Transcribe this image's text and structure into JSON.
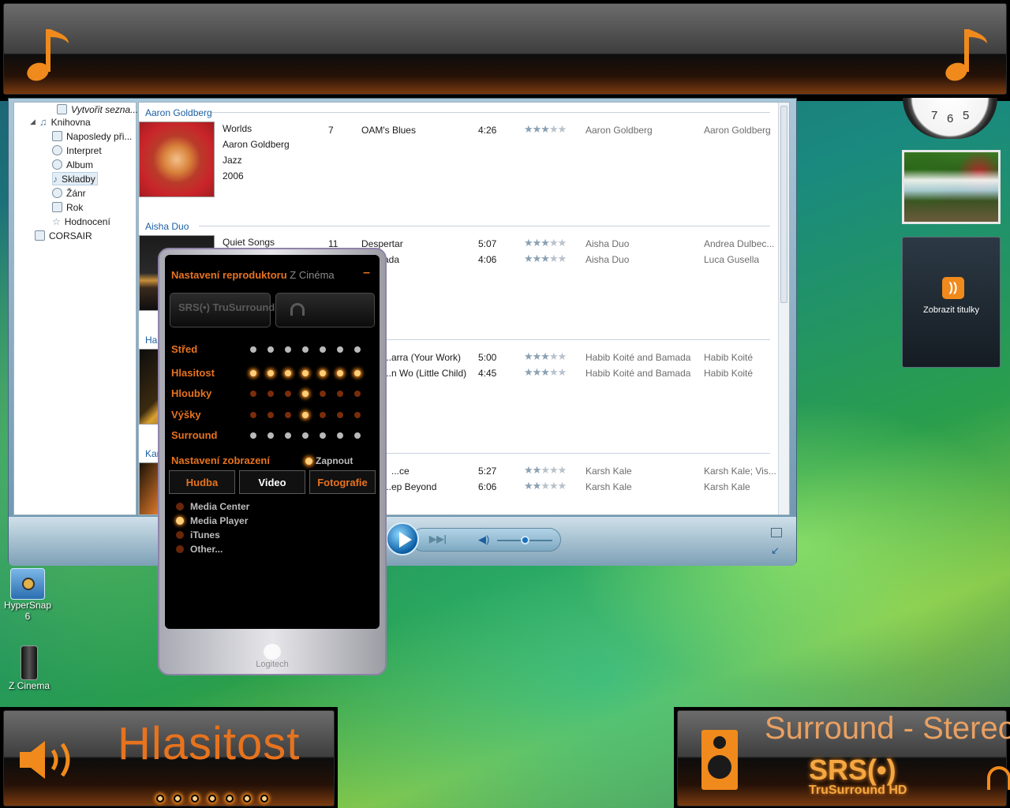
{
  "top_bar": {
    "left_icon": "music-note-icon",
    "right_icon": "music-note-icon"
  },
  "navigation": {
    "items": [
      {
        "label": "Vytvořit sezna...",
        "icon": "playlist-icon"
      },
      {
        "label": "Knihovna",
        "icon": "music-library-icon"
      },
      {
        "label": "Naposledy při...",
        "icon": "recent-icon"
      },
      {
        "label": "Interpret",
        "icon": "artist-icon"
      },
      {
        "label": "Album",
        "icon": "album-icon"
      },
      {
        "label": "Skladby",
        "icon": "song-icon",
        "selected": true
      },
      {
        "label": "Žánr",
        "icon": "genre-icon"
      },
      {
        "label": "Rok",
        "icon": "year-icon"
      },
      {
        "label": "Hodnocení",
        "icon": "rating-star-icon"
      },
      {
        "label": "CORSAIR",
        "icon": "drive-icon"
      }
    ]
  },
  "library": {
    "groups": [
      {
        "artist": "Aaron Goldberg",
        "album": "Worlds",
        "album_artist": "Aaron Goldberg",
        "genre": "Jazz",
        "year": "2006",
        "tracks": [
          {
            "num": "7",
            "title": "OAM's Blues",
            "length": "4:26",
            "rating": 3,
            "contributing": "Aaron Goldberg",
            "composer": "Aaron Goldberg"
          }
        ]
      },
      {
        "artist": "Aisha Duo",
        "album": "Quiet Songs",
        "tracks": [
          {
            "num": "11",
            "title": "Despertar",
            "length": "5:07",
            "rating": 3,
            "contributing": "Aisha Duo",
            "composer": "Andrea Dulbec..."
          },
          {
            "num": "",
            "title": "...ada",
            "length": "4:06",
            "rating": 3,
            "contributing": "Aisha Duo",
            "composer": "Luca Gusella"
          }
        ]
      },
      {
        "artist": "Hal...",
        "tracks": [
          {
            "title": "...arra (Your Work)",
            "length": "5:00",
            "rating": 3,
            "contributing": "Habib Koité and Bamada",
            "composer": "Habib Koité"
          },
          {
            "title": "...n Wo (Little Child)",
            "length": "4:45",
            "rating": 3,
            "contributing": "Habib Koité and Bamada",
            "composer": "Habib Koité"
          }
        ]
      },
      {
        "artist": "Kar...",
        "tracks": [
          {
            "title": "...ce",
            "length": "5:27",
            "rating": 2,
            "contributing": "Karsh Kale",
            "composer": "Karsh Kale; Vis..."
          },
          {
            "title": "...ep Beyond",
            "length": "6:06",
            "rating": 2,
            "contributing": "Karsh Kale",
            "composer": "Karsh Kale"
          }
        ]
      }
    ]
  },
  "player_controls": {
    "play_icon": "play-icon",
    "next_icon": "next-track-icon",
    "volume_icon": "volume-icon",
    "volume_level": 0.5
  },
  "gadgets": {
    "rss_label": "Zobrazit titulky",
    "rss_icon": "rss-feed-icon"
  },
  "desktop_icons": [
    {
      "label": "HyperSnap 6",
      "icon": "camera-icon"
    },
    {
      "label": "Z Cinema",
      "icon": "speaker-icon"
    }
  ],
  "zcinema": {
    "title_prefix": "Nastavení reproduktoru",
    "title_brand": "Z Cinéma",
    "minimize_label": "–",
    "srs_logo": "SRS(•) TruSurround HD",
    "rows": [
      {
        "label": "Střed",
        "level": 0,
        "style": "gray"
      },
      {
        "label": "Hlasitost",
        "level": 7,
        "style": "on"
      },
      {
        "label": "Hloubky",
        "level": 4,
        "style": "marker"
      },
      {
        "label": "Výšky",
        "level": 4,
        "style": "marker"
      },
      {
        "label": "Surround",
        "level": 0,
        "style": "gray"
      }
    ],
    "display_settings_label": "Nastavení zobrazení",
    "display_toggle_label": "Zapnout",
    "tabs": [
      {
        "label": "Hudba"
      },
      {
        "label": "Video",
        "selected": true
      },
      {
        "label": "Fotografie"
      }
    ],
    "sources": [
      {
        "label": "Media Center",
        "selected": false
      },
      {
        "label": "Media Player",
        "selected": true
      },
      {
        "label": "iTunes",
        "selected": false
      },
      {
        "label": "Other...",
        "selected": false
      }
    ],
    "footer_brand": "Logitech"
  },
  "bottom_left": {
    "title": "Hlasitost",
    "icon": "speaker-volume-icon",
    "volume_dots": 7
  },
  "bottom_right": {
    "title": "Surround - Stereo",
    "logo": "SRS(•)",
    "logo_sub": "TruSurround HD",
    "icon": "speaker-icon",
    "headphone_icon": "headphones-icon"
  },
  "colors": {
    "accent": "#e7731e",
    "glow": "#ffcf7a"
  }
}
